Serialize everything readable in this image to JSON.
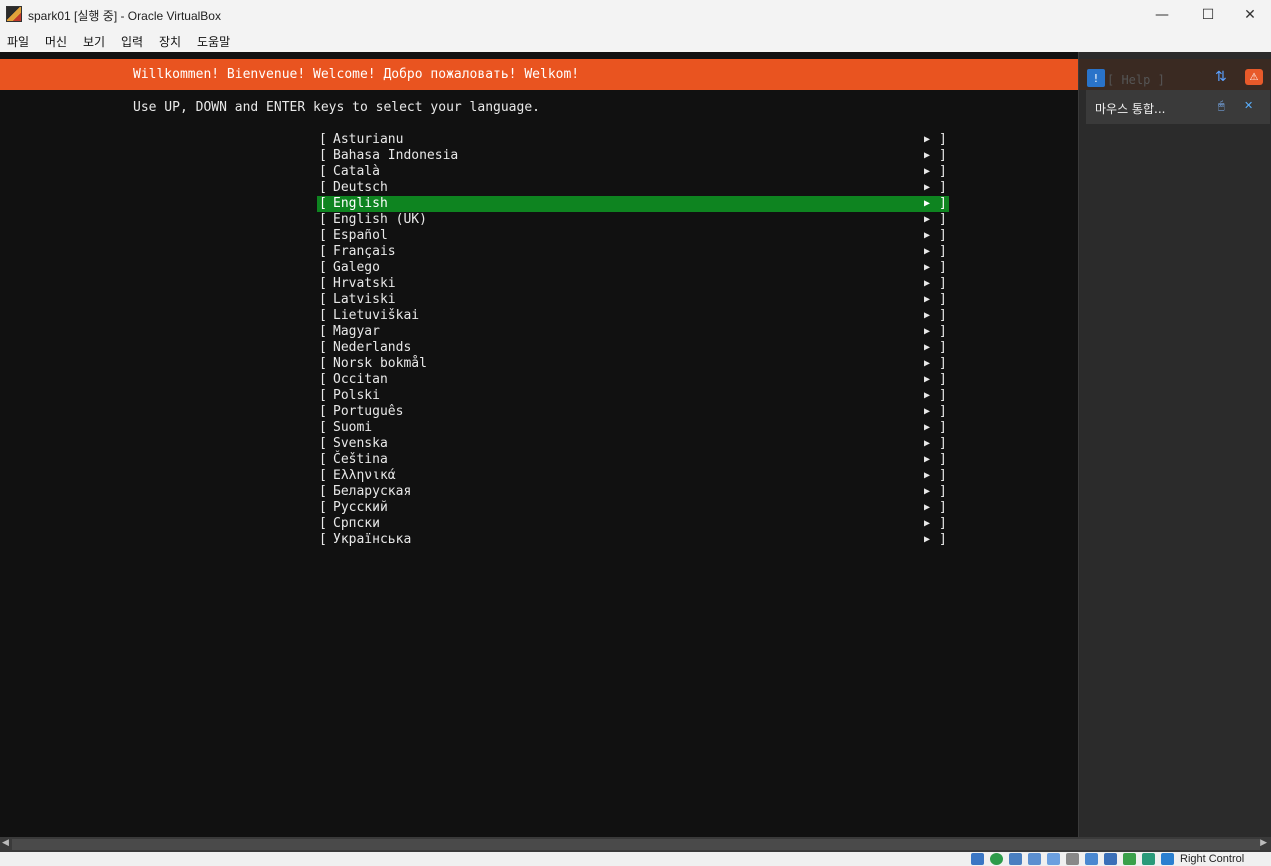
{
  "window": {
    "title": "spark01 [실행 중] - Oracle VirtualBox",
    "minimize": "—",
    "maximize": "☐",
    "close": "✕"
  },
  "menu": [
    "파일",
    "머신",
    "보기",
    "입력",
    "장치",
    "도움말"
  ],
  "installer": {
    "banner": "Willkommen! Bienvenue! Welcome! Добро пожаловать! Welkom!",
    "instruction": "Use UP, DOWN and ENTER keys to select your language.",
    "selected": "English",
    "languages": [
      "Asturianu",
      "Bahasa Indonesia",
      "Català",
      "Deutsch",
      "English",
      "English (UK)",
      "Español",
      "Français",
      "Galego",
      "Hrvatski",
      "Latviski",
      "Lietuviškai",
      "Magyar",
      "Nederlands",
      "Norsk bokmål",
      "Occitan",
      "Polski",
      "Português",
      "Suomi",
      "Svenska",
      "Čeština",
      "Ελληνικά",
      "Беларуская",
      "Русский",
      "Српски",
      "Українська"
    ]
  },
  "side_panel": {
    "ghost_text": "[ Help ]",
    "mouse_integration": "마우스 통합..."
  },
  "statusbar": {
    "host_key": "Right Control"
  },
  "colors": {
    "banner": "#e95420",
    "selected_row": "#0e8420",
    "terminal_bg": "#111111"
  }
}
